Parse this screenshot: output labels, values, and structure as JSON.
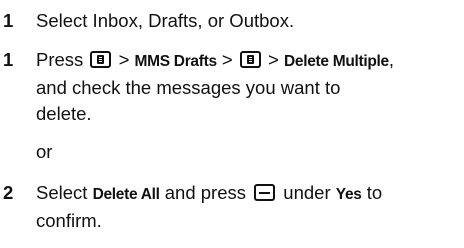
{
  "steps": [
    {
      "number": "1",
      "text": "Select Inbox, Drafts, or Outbox."
    },
    {
      "number": "1",
      "t1": "Press ",
      "t2": " > ",
      "key_mms_drafts": "MMS Drafts",
      "t3": " > ",
      "t4": " > ",
      "key_delete_multiple": "Delete Multiple",
      "t5": ",",
      "line2": "and check the messages you want to",
      "line3": "delete."
    },
    {
      "number": "2",
      "t1": "Select ",
      "key_delete_all": "Delete All",
      "t2": " and press ",
      "t3": " under ",
      "key_yes": "Yes",
      "t4": " to",
      "line2": "confirm."
    }
  ],
  "or_text": "or",
  "icons": {
    "menu_key": "menu-key-icon",
    "soft_key": "soft-key-icon"
  }
}
